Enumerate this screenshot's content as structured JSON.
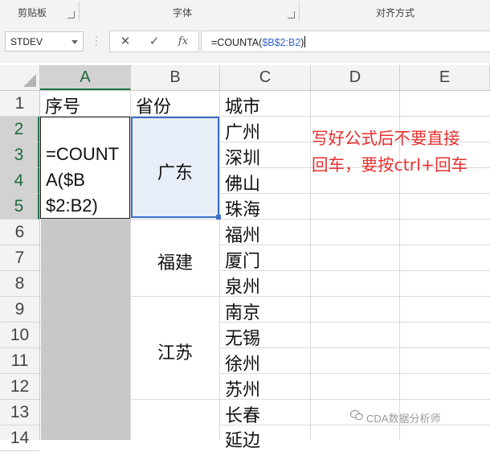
{
  "ribbon": {
    "groups": [
      {
        "label": "剪贴板"
      },
      {
        "label": "字体"
      },
      {
        "label": "对齐方式"
      }
    ]
  },
  "formula_bar": {
    "name_box": "STDEV",
    "cancel_icon": "✕",
    "enter_icon": "✓",
    "fx_icon": "fx",
    "formula_prefix": "=COUNTA(",
    "formula_ref": "$B$2:B2",
    "formula_suffix": ")"
  },
  "columns": [
    "A",
    "B",
    "C",
    "D",
    "E"
  ],
  "selected_column": "A",
  "rows": [
    "1",
    "2",
    "3",
    "4",
    "5",
    "6",
    "7",
    "8",
    "9",
    "10",
    "11",
    "12",
    "13",
    "14"
  ],
  "headers": {
    "A": "序号",
    "B": "省份",
    "C": "城市"
  },
  "editing_cell": {
    "line1": "=COUNT",
    "line2": "A($B",
    "line3": "$2:B2)"
  },
  "provinces": [
    {
      "name": "广东"
    },
    {
      "name": "福建"
    },
    {
      "name": "江苏"
    }
  ],
  "cities": [
    "广州",
    "深圳",
    "佛山",
    "珠海",
    "福州",
    "厦门",
    "泉州",
    "南京",
    "无锡",
    "徐州",
    "苏州",
    "长春",
    "延边"
  ],
  "note": {
    "line1": "写好公式后不要直接",
    "line2": "回车，要按ctrl+回车"
  },
  "watermark": "CDA数据分析师",
  "colors": {
    "accent_green": "#217346",
    "selection_blue": "#3a6fc6",
    "note_red": "#e8312f",
    "ref_blue": "#3366cc"
  }
}
